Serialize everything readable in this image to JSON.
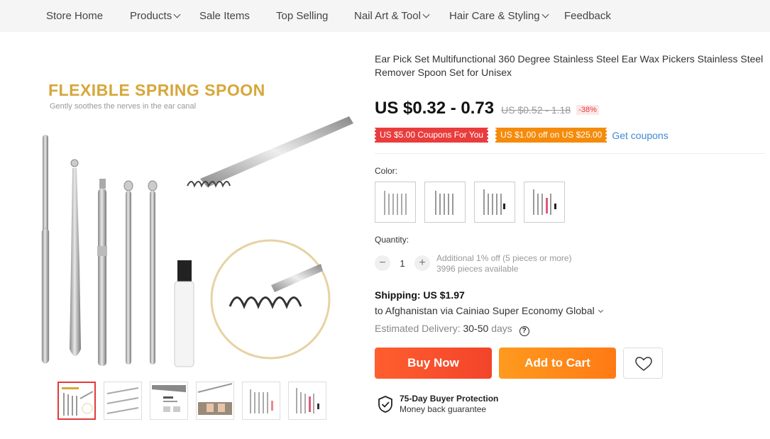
{
  "nav": {
    "items": [
      {
        "label": "Store Home",
        "dropdown": false
      },
      {
        "label": "Products",
        "dropdown": true
      },
      {
        "label": "Sale Items",
        "dropdown": false
      },
      {
        "label": "Top Selling",
        "dropdown": false
      },
      {
        "label": "Nail Art & Tool",
        "dropdown": true
      },
      {
        "label": "Hair Care & Styling",
        "dropdown": true
      },
      {
        "label": "Feedback",
        "dropdown": false
      }
    ]
  },
  "gallery": {
    "hero_title": "FLEXIBLE SPRING SPOON",
    "hero_subtitle": "Gently soothes the nerves in the ear canal",
    "thumbnail_count": 6,
    "active_thumbnail": 1
  },
  "product": {
    "title": "Ear Pick Set Multifunctional 360 Degree Stainless Steel Ear Wax Pickers Stainless Steel Remover Spoon Set for Unisex",
    "price": "US $0.32 - 0.73",
    "original_price": "US $0.52 - 1.18",
    "discount": "-38%"
  },
  "coupons": {
    "coupon1": "US $5.00 Coupons For You",
    "coupon2": "US $1.00 off on US $25.00",
    "get_label": "Get coupons"
  },
  "color": {
    "label": "Color:",
    "option_count": 4
  },
  "quantity": {
    "label": "Quantity:",
    "minus": "−",
    "value": "1",
    "plus": "+",
    "note": "Additional 1% off (5 pieces or more)",
    "available": "3996 pieces available"
  },
  "shipping": {
    "title": "Shipping: US $1.97",
    "route": "to Afghanistan via Cainiao Super Economy Global",
    "delivery_label": "Estimated Delivery:",
    "delivery_days": "30-50",
    "delivery_unit": "days",
    "help": "?"
  },
  "actions": {
    "buy_now": "Buy Now",
    "add_to_cart": "Add to Cart"
  },
  "protection": {
    "title": "75-Day Buyer Protection",
    "subtitle": "Money back guarantee"
  },
  "colors": {
    "accent_red": "#e4393c",
    "buy_gradient": "#f2442a",
    "cart_gradient": "#ff7a14",
    "coupon_red": "#ea3c3c",
    "coupon_orange": "#f58b0a",
    "link_blue": "#3e8bd6",
    "hero_gold": "#d6a73a"
  }
}
